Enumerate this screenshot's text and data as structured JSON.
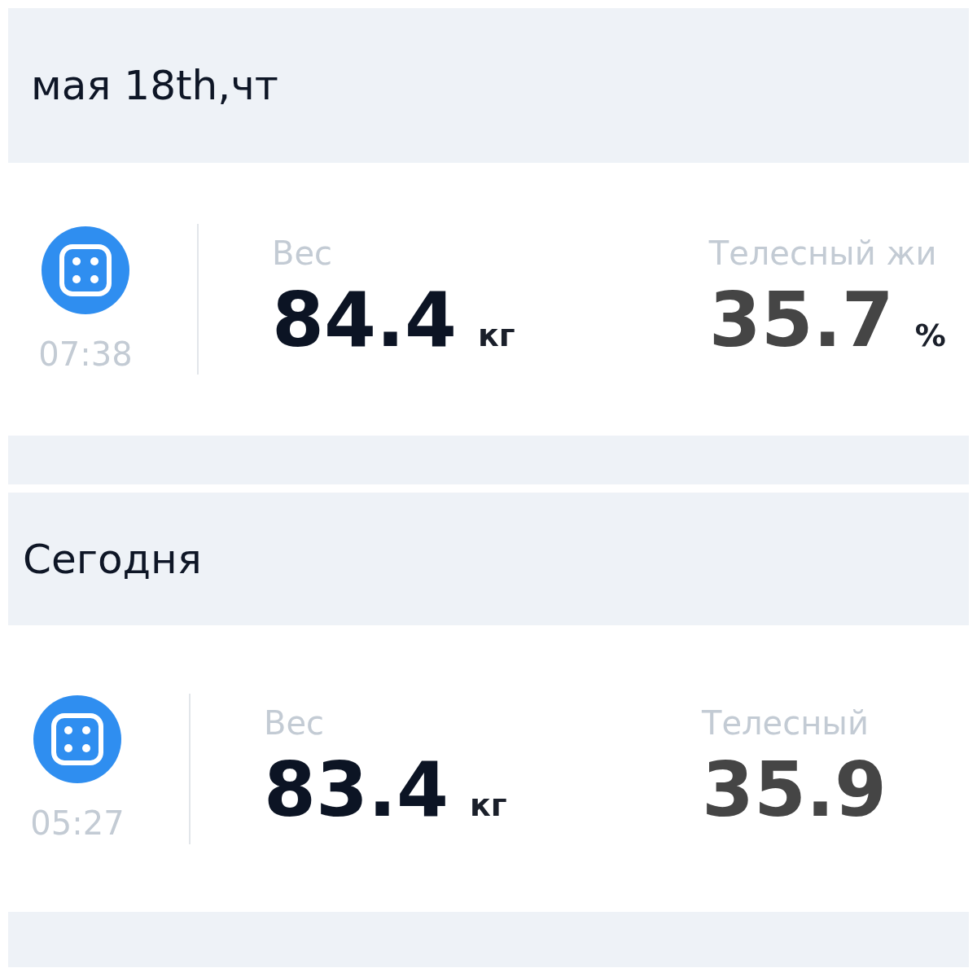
{
  "days": [
    {
      "date": "мая 18th,чт",
      "records": [
        {
          "time": "07:38",
          "metrics": [
            {
              "label": "Вес",
              "value": "84.4",
              "unit": "кг",
              "kind": "primary"
            },
            {
              "label": "Телесный жи",
              "value": "35.7",
              "unit": "%",
              "kind": "secondary"
            }
          ]
        }
      ]
    },
    {
      "date": "Сегодня",
      "records": [
        {
          "time": "05:27",
          "metrics": [
            {
              "label": "Вес",
              "value": "83.4",
              "unit": "кг",
              "kind": "primary"
            },
            {
              "label": "Телесный",
              "value": "35.9",
              "kind": "secondary"
            }
          ]
        }
      ]
    }
  ]
}
